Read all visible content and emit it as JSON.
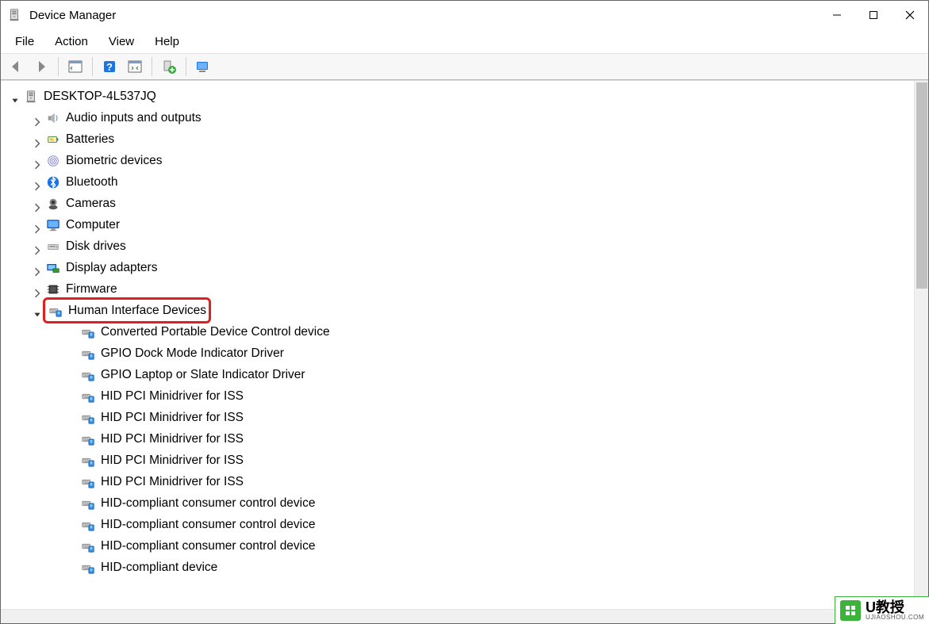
{
  "title": "Device Manager",
  "menu": {
    "file": "File",
    "action": "Action",
    "view": "View",
    "help": "Help"
  },
  "tree": {
    "root": "DESKTOP-4L537JQ",
    "categories": [
      {
        "label": "Audio inputs and outputs",
        "expanded": false,
        "icon": "speaker"
      },
      {
        "label": "Batteries",
        "expanded": false,
        "icon": "battery"
      },
      {
        "label": "Biometric devices",
        "expanded": false,
        "icon": "fingerprint"
      },
      {
        "label": "Bluetooth",
        "expanded": false,
        "icon": "bluetooth"
      },
      {
        "label": "Cameras",
        "expanded": false,
        "icon": "camera"
      },
      {
        "label": "Computer",
        "expanded": false,
        "icon": "monitor"
      },
      {
        "label": "Disk drives",
        "expanded": false,
        "icon": "disk"
      },
      {
        "label": "Display adapters",
        "expanded": false,
        "icon": "display"
      },
      {
        "label": "Firmware",
        "expanded": false,
        "icon": "chip"
      },
      {
        "label": "Human Interface Devices",
        "expanded": true,
        "icon": "hid",
        "highlighted": true,
        "children": [
          "Converted Portable Device Control device",
          "GPIO Dock Mode Indicator Driver",
          "GPIO Laptop or Slate Indicator Driver",
          "HID PCI Minidriver for ISS",
          "HID PCI Minidriver for ISS",
          "HID PCI Minidriver for ISS",
          "HID PCI Minidriver for ISS",
          "HID PCI Minidriver for ISS",
          "HID-compliant consumer control device",
          "HID-compliant consumer control device",
          "HID-compliant consumer control device",
          "HID-compliant device"
        ]
      }
    ]
  },
  "watermark": {
    "brand": "U教授",
    "url": "UJIAOSHOU.COM"
  }
}
